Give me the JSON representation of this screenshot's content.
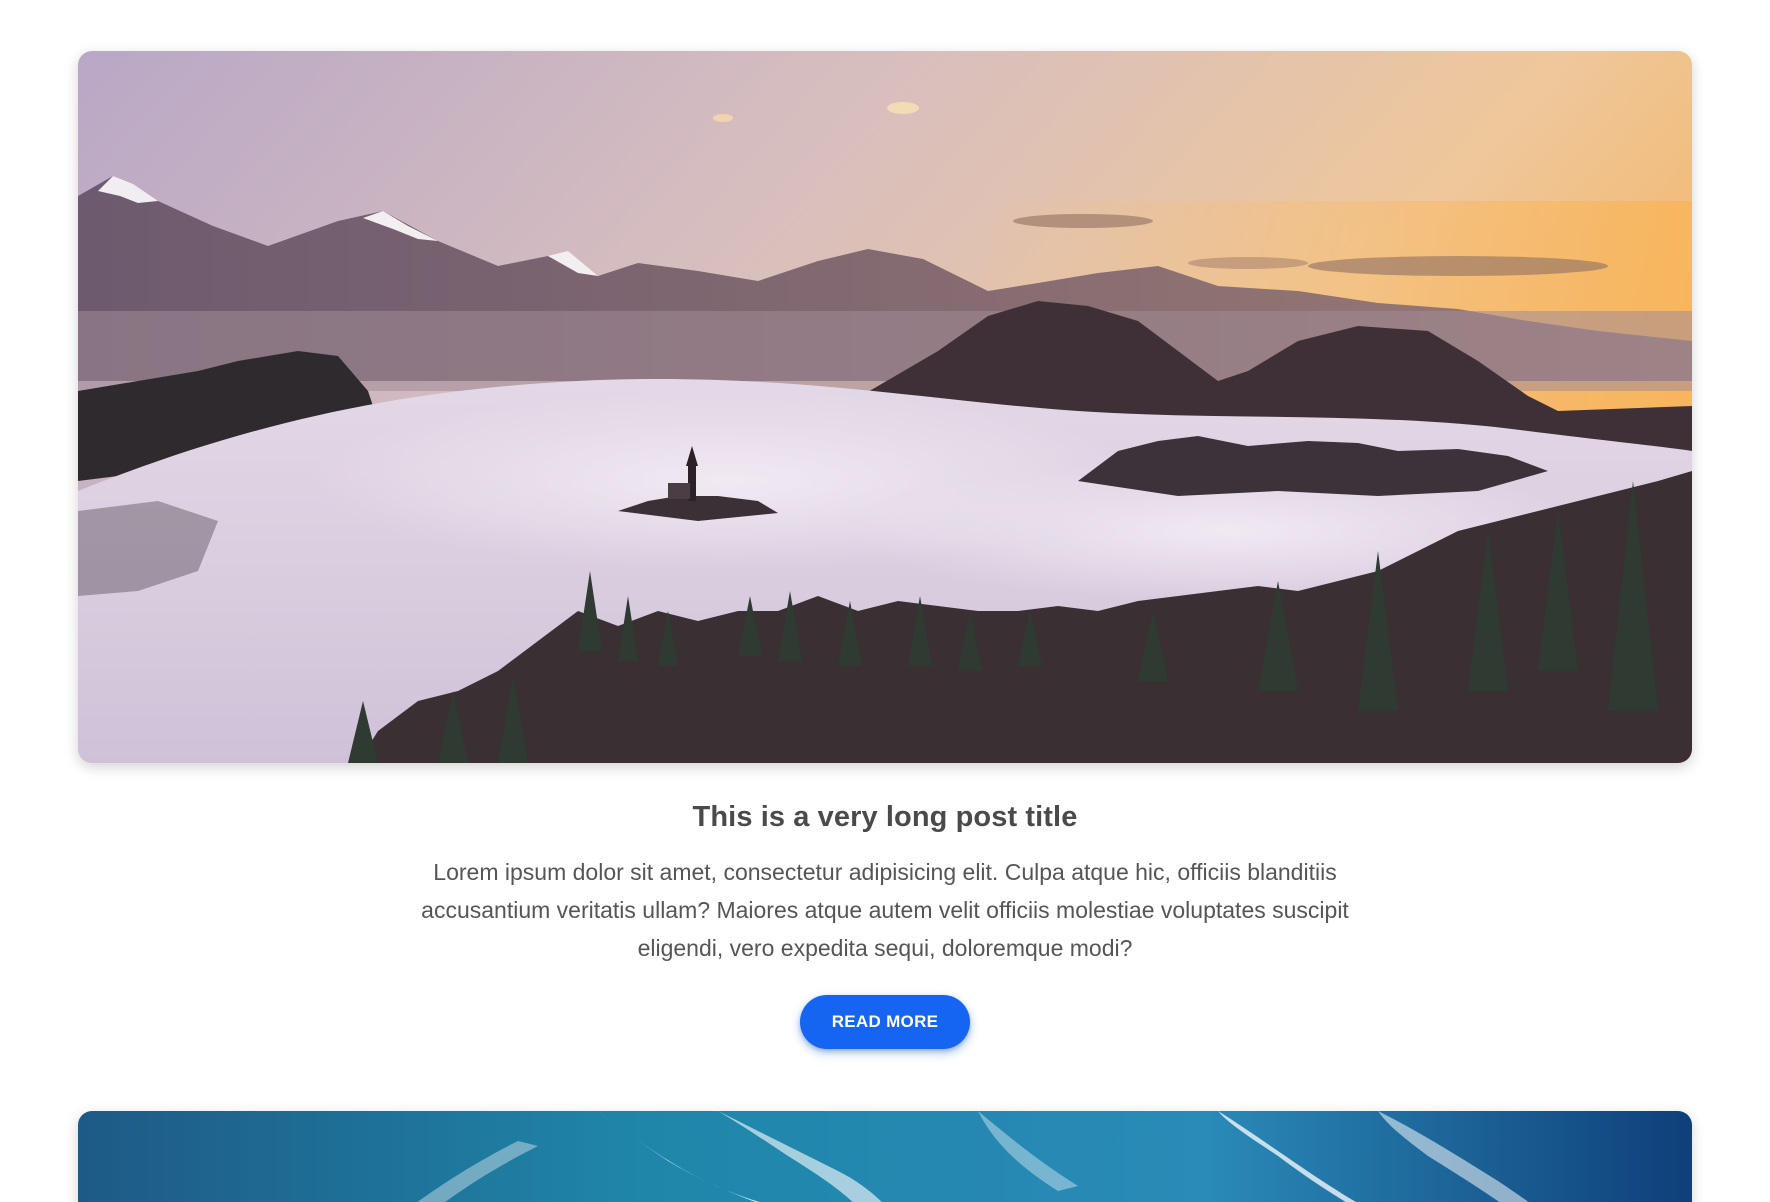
{
  "theme": {
    "accent": "#1565f2",
    "title_color": "#4a4a4a",
    "text_color": "#555555"
  },
  "posts": [
    {
      "image_subject": "misty-mountain-lake-sunrise",
      "title": "This is a very long post title",
      "excerpt": "Lorem ipsum dolor sit amet, consectetur adipisicing elit. Culpa atque hic, officiis blanditiis accusantium veritatis ullam? Maiores atque autem velit officiis molestiae voluptates suscipit eligendi, vero expedita sequi, doloremque modi?",
      "button_label": "READ MORE"
    },
    {
      "image_subject": "blue-sky-with-clouds"
    }
  ]
}
